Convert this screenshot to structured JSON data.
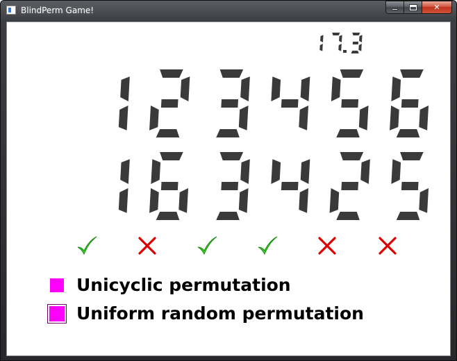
{
  "window": {
    "title": "BlindPerm Game!",
    "buttons": {
      "minimize": "minimize",
      "maximize": "maximize",
      "close": "close"
    }
  },
  "timer": {
    "value": "17.3"
  },
  "permutation": {
    "top_row": [
      "1",
      "2",
      "3",
      "4",
      "5",
      "6"
    ],
    "bottom_row": [
      "1",
      "6",
      "3",
      "4",
      "2",
      "5"
    ],
    "results": [
      "check",
      "cross",
      "check",
      "check",
      "cross",
      "cross"
    ]
  },
  "legend": {
    "items": [
      {
        "label": "Unicyclic permutation",
        "selected": false
      },
      {
        "label": "Uniform random permutation",
        "selected": true
      }
    ]
  },
  "colors": {
    "digit": "#3a3a3a",
    "check": "#33dd22",
    "cross": "#dd0000",
    "swatch": "#ff00ff"
  },
  "icons": {
    "check": "check-icon",
    "cross": "cross-icon"
  }
}
